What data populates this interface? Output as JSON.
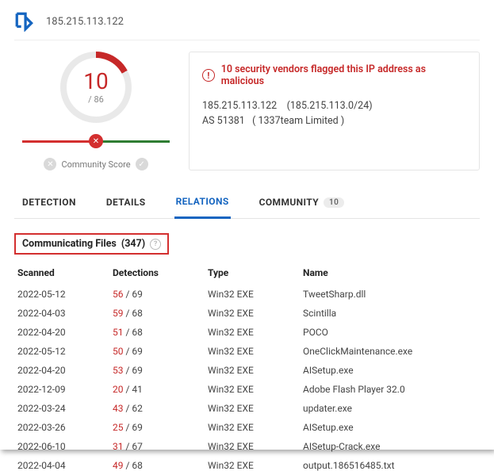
{
  "header": {
    "ip": "185.215.113.122"
  },
  "score": {
    "flagged": "10",
    "total_prefix": "/ ",
    "total": "86",
    "community_label": "Community Score"
  },
  "info": {
    "alert": "10 security vendors flagged this IP address as malicious",
    "line1_ip": "185.215.113.122",
    "line1_cidr": "(185.215.113.0/24)",
    "line2_as": "AS 51381",
    "line2_org": "( 1337team Limited )"
  },
  "tabs": {
    "detection": "DETECTION",
    "details": "DETAILS",
    "relations": "RELATIONS",
    "community": "COMMUNITY",
    "community_count": "10"
  },
  "section": {
    "title": "Communicating Files",
    "count": "(347)"
  },
  "table": {
    "headers": {
      "scanned": "Scanned",
      "detections": "Detections",
      "type": "Type",
      "name": "Name"
    },
    "rows": [
      {
        "scanned": "2022-05-12",
        "hit": "56",
        "tot": "69",
        "type": "Win32 EXE",
        "name": "TweetSharp.dll"
      },
      {
        "scanned": "2022-04-03",
        "hit": "59",
        "tot": "68",
        "type": "Win32 EXE",
        "name": "Scintilla"
      },
      {
        "scanned": "2022-04-20",
        "hit": "51",
        "tot": "68",
        "type": "Win32 EXE",
        "name": "POCO"
      },
      {
        "scanned": "2022-05-12",
        "hit": "50",
        "tot": "69",
        "type": "Win32 EXE",
        "name": "OneClickMaintenance.exe"
      },
      {
        "scanned": "2022-04-20",
        "hit": "53",
        "tot": "69",
        "type": "Win32 EXE",
        "name": "AISetup.exe"
      },
      {
        "scanned": "2022-12-09",
        "hit": "20",
        "tot": "41",
        "type": "Win32 EXE",
        "name": "Adobe Flash Player 32.0"
      },
      {
        "scanned": "2022-03-24",
        "hit": "43",
        "tot": "62",
        "type": "Win32 EXE",
        "name": "updater.exe"
      },
      {
        "scanned": "2022-03-26",
        "hit": "25",
        "tot": "69",
        "type": "Win32 EXE",
        "name": "AISetup.exe"
      },
      {
        "scanned": "2022-06-10",
        "hit": "31",
        "tot": "67",
        "type": "Win32 EXE",
        "name": "AISetup-Crack.exe"
      },
      {
        "scanned": "2022-04-04",
        "hit": "49",
        "tot": "68",
        "type": "Win32 EXE",
        "name": "output.186516485.txt"
      }
    ]
  }
}
